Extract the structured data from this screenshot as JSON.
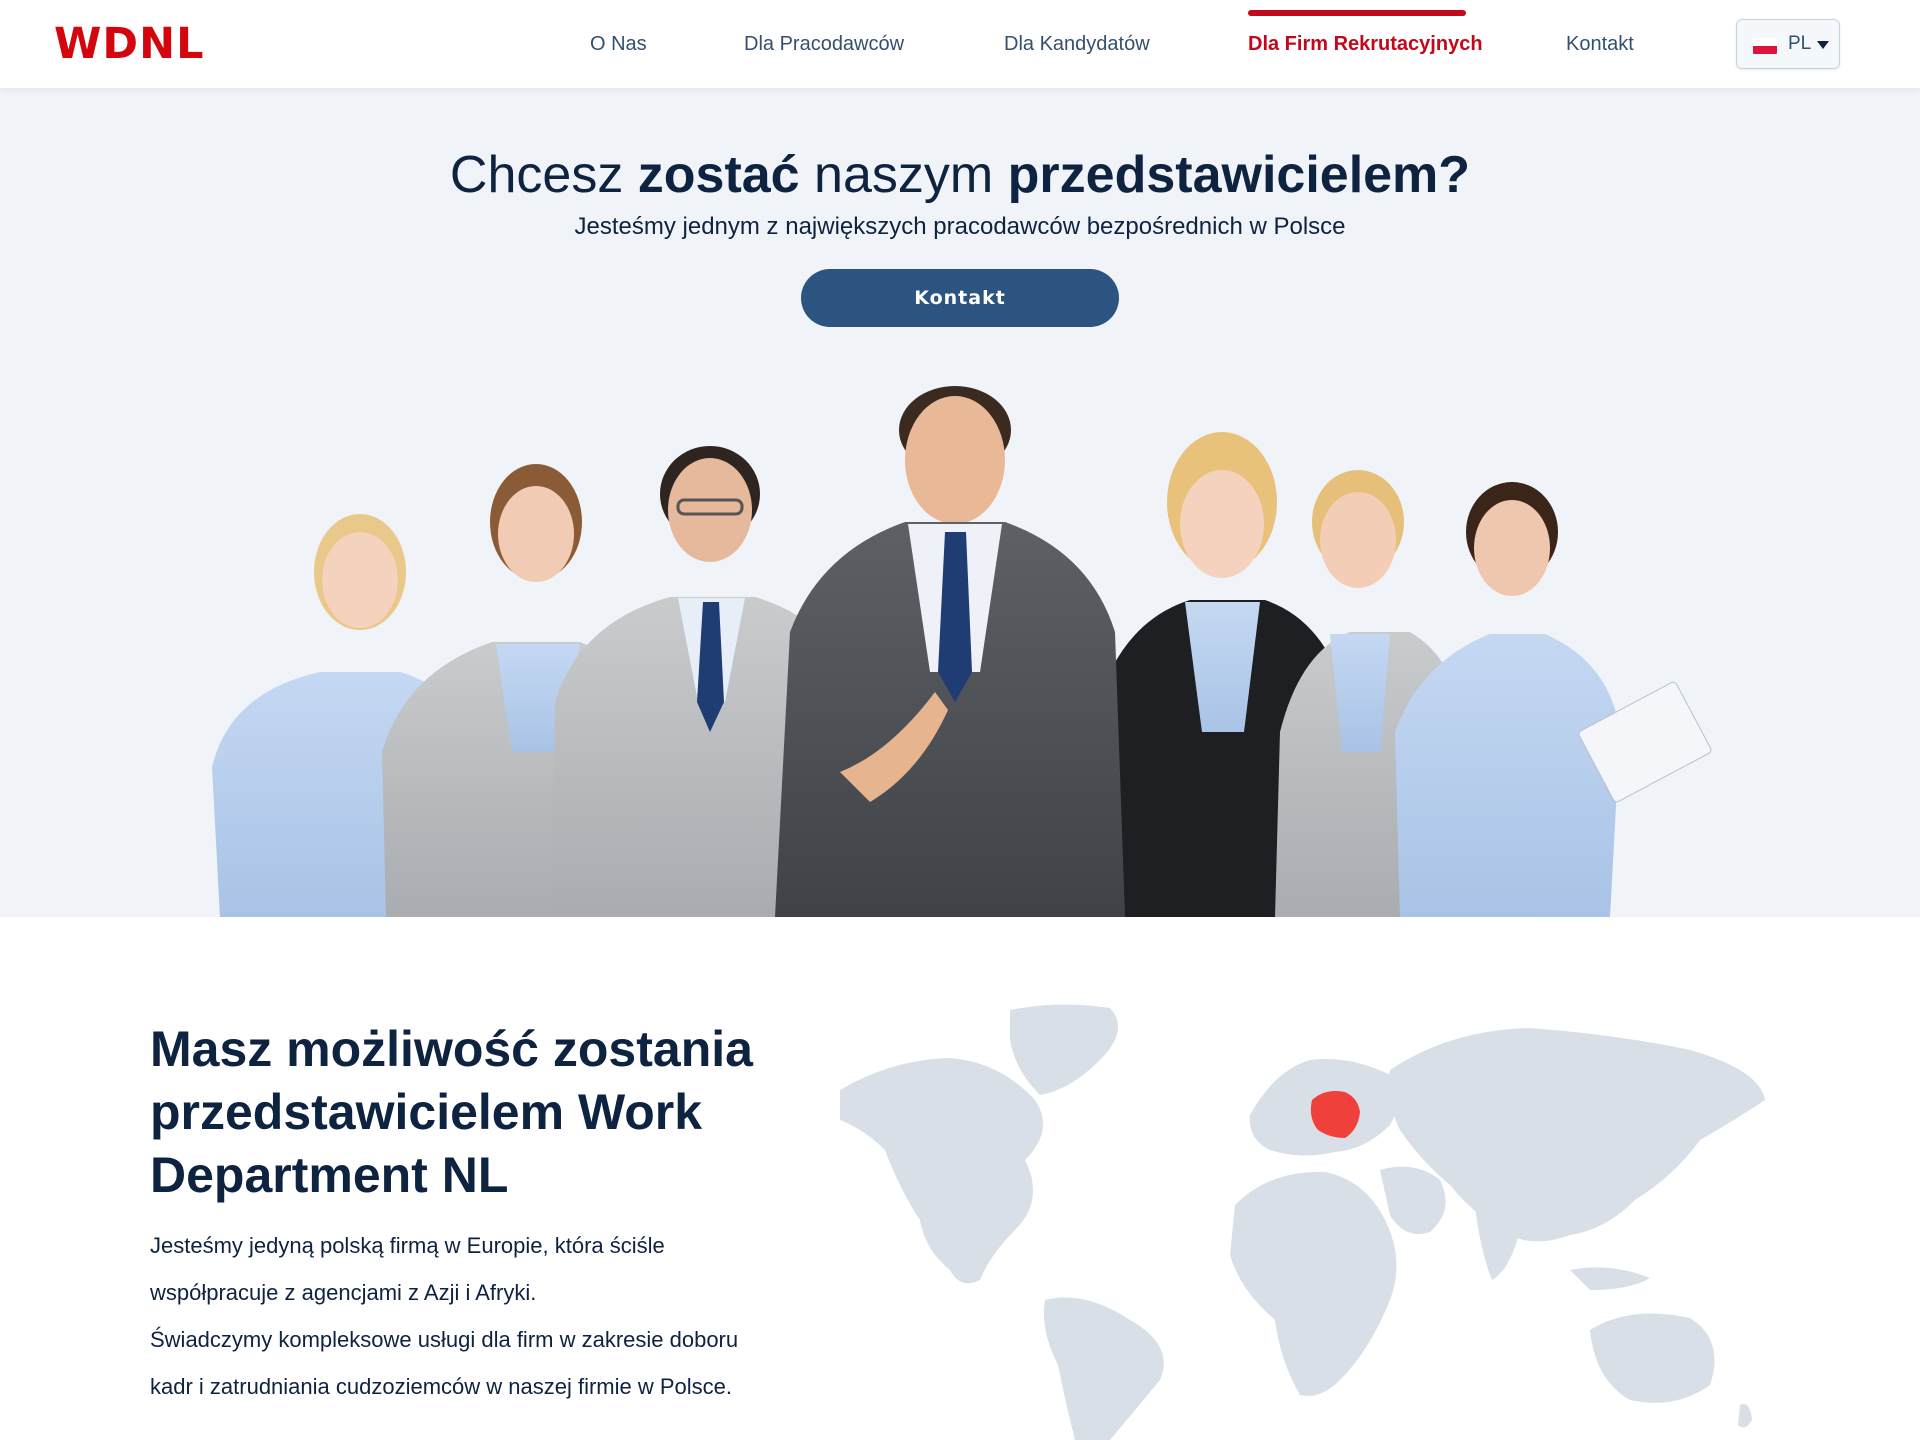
{
  "header": {
    "logo": "WDNL",
    "nav": [
      {
        "label": "O Nas"
      },
      {
        "label": "Dla Pracodawców"
      },
      {
        "label": "Dla Kandydatów"
      },
      {
        "label": "Dla Firm Rekrutacyjnych",
        "active": true
      },
      {
        "label": "Kontakt"
      }
    ],
    "language": {
      "code": "PL",
      "flag": "poland-flag-icon"
    }
  },
  "hero": {
    "title_parts": [
      "Chcesz ",
      "zostać",
      " naszym ",
      "przedstawicielem?"
    ],
    "subtitle": "Jesteśmy jednym z największych pracodawców bezpośrednich w Polsce",
    "button_label": "Kontakt",
    "image": "business-team-photo"
  },
  "about": {
    "title": "Masz możliwość zostania przedstawicielem Work Department NL",
    "paragraphs": [
      "Jesteśmy jedyną polską firmą w Europie, która ściśle współpracuje z agencjami z Azji i Afryki.",
      "Świadczymy kompleksowe usługi dla firm w zakresie doboru kadr i zatrudniania cudzoziemców w naszej firmie w Polsce."
    ],
    "map": {
      "image": "world-map",
      "highlighted_country": "Poland"
    }
  },
  "colors": {
    "brand_red": "#d3060e",
    "active_nav": "#c3081a",
    "button_blue": "#2b5580",
    "text_navy": "#0d2340",
    "hero_bg": "#f0f3f7",
    "map_land": "#d8dfe7",
    "map_highlight": "#f0403c"
  }
}
